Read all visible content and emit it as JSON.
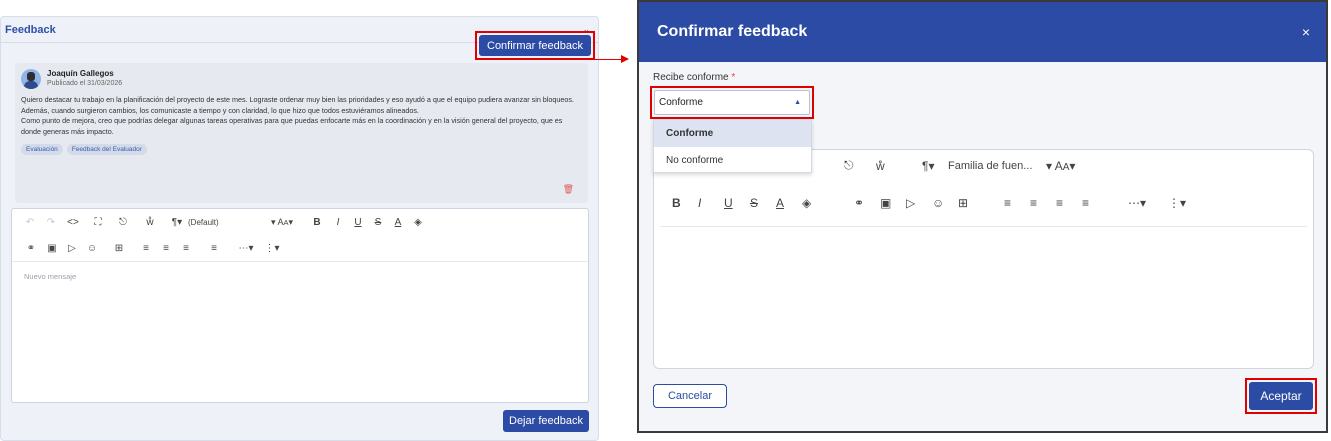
{
  "left": {
    "header_title": "Feedback",
    "confirm_button": "Confirmar feedback",
    "comment": {
      "author": "Joaquín Gallegos",
      "published": "Publicado el 31/03/2026",
      "paragraph1": "Quiero destacar tu trabajo en la planificación del proyecto de este mes. Lograste ordenar muy bien las prioridades y eso ayudó a que el equipo pudiera avanzar sin bloqueos. Además, cuando surgieron cambios, los comunicaste a tiempo y con claridad, lo que hizo que todos estuviéramos alineados.",
      "paragraph2": "Como punto de mejora, creo que podrías delegar algunas tareas operativas para que puedas enfocarte más en la coordinación y en la visión general del proyecto, que es donde generas más impacto.",
      "tags": [
        "Evaluación",
        "Feedback del Evaluador"
      ]
    },
    "editor": {
      "paragraph_style": "(Default)",
      "placeholder": "Nuevo mensaje"
    },
    "submit_button": "Dejar feedback"
  },
  "modal": {
    "title": "Confirmar feedback",
    "close_glyph": "×",
    "field_label": "Recibe conforme",
    "required_mark": "*",
    "selected_value": "Conforme",
    "options": [
      "Conforme",
      "No conforme"
    ],
    "editor": {
      "font_family": "Familia de fuen..."
    },
    "cancel_button": "Cancelar",
    "accept_button": "Aceptar"
  },
  "colors": {
    "accent": "#2c4ba4",
    "highlight": "#e00000"
  }
}
